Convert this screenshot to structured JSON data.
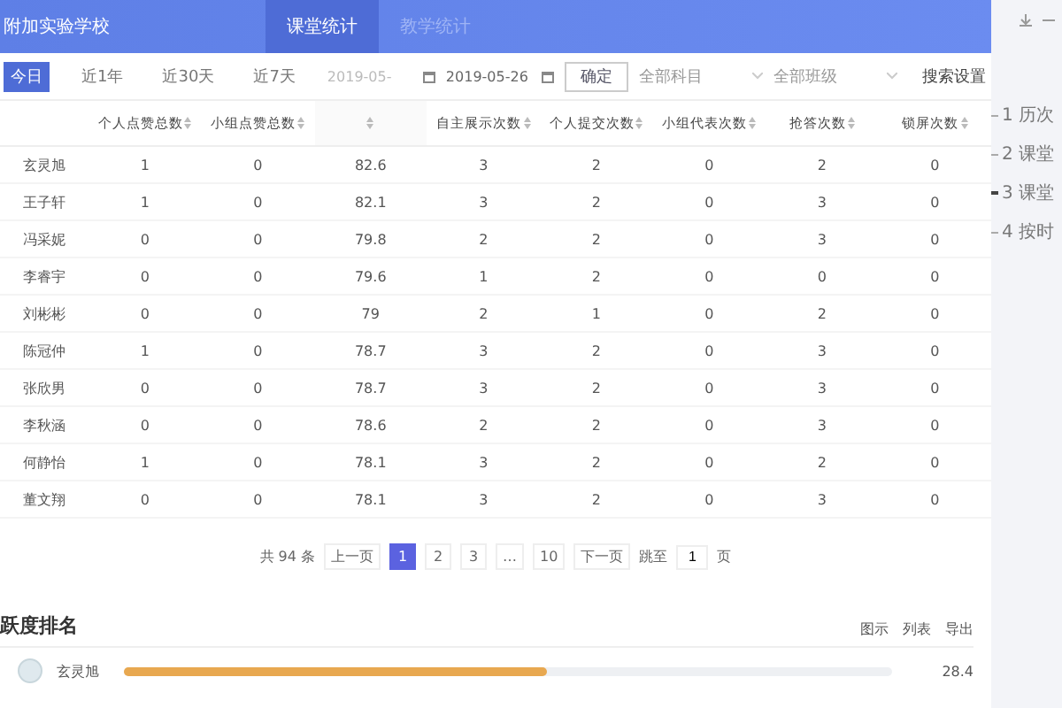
{
  "header": {
    "title": "附加实验学校",
    "tabs": [
      {
        "label": "课堂统计",
        "selected": true
      },
      {
        "label": "教学统计",
        "selected": false
      }
    ]
  },
  "filters": {
    "ranges": [
      {
        "label": "今日",
        "selected": true
      },
      {
        "label": "近1年",
        "selected": false
      },
      {
        "label": "近30天",
        "selected": false
      },
      {
        "label": "近7天",
        "selected": false
      }
    ],
    "start_date": {
      "placeholder": "2019-05-"
    },
    "end_date": {
      "value": "2019-05-26"
    },
    "confirm": "确定",
    "subject": "全部科目",
    "class": "全部班级",
    "search_settings": "搜索设置"
  },
  "table": {
    "columns": [
      {},
      {
        "label": "个人点赞总数"
      },
      {
        "label": "小组点赞总数"
      },
      {},
      {
        "label": "自主展示次数"
      },
      {
        "label": "个人提交次数"
      },
      {
        "label": "小组代表次数"
      },
      {
        "label": "抢答次数"
      },
      {
        "label": "锁屏次数"
      }
    ],
    "rows": [
      [
        "玄灵旭",
        "1",
        "0",
        "82.6",
        "3",
        "2",
        "0",
        "2",
        "0"
      ],
      [
        "王子轩",
        "1",
        "0",
        "82.1",
        "3",
        "2",
        "0",
        "3",
        "0"
      ],
      [
        "冯采妮",
        "0",
        "0",
        "79.8",
        "2",
        "2",
        "0",
        "3",
        "0"
      ],
      [
        "李睿宇",
        "0",
        "0",
        "79.6",
        "1",
        "2",
        "0",
        "0",
        "0"
      ],
      [
        "刘彬彬",
        "0",
        "0",
        "79",
        "2",
        "1",
        "0",
        "2",
        "0"
      ],
      [
        "陈冠仲",
        "1",
        "0",
        "78.7",
        "3",
        "2",
        "0",
        "3",
        "0"
      ],
      [
        "张欣男",
        "0",
        "0",
        "78.7",
        "3",
        "2",
        "0",
        "3",
        "0"
      ],
      [
        "李秋涵",
        "0",
        "0",
        "78.6",
        "2",
        "2",
        "0",
        "3",
        "0"
      ],
      [
        "何静怡",
        "1",
        "0",
        "78.1",
        "3",
        "2",
        "0",
        "2",
        "0"
      ],
      [
        "董文翔",
        "0",
        "0",
        "78.1",
        "3",
        "2",
        "0",
        "3",
        "0"
      ]
    ]
  },
  "pagination": {
    "total": "共 94 条",
    "prev": "上一页",
    "pages": [
      {
        "label": "1",
        "selected": true
      },
      {
        "label": "2",
        "selected": false
      },
      {
        "label": "3",
        "selected": false
      },
      {
        "label": "…",
        "selected": false
      },
      {
        "label": "10",
        "selected": false
      }
    ],
    "next": "下一页",
    "jump": "跳至",
    "page_input": "1",
    "page_unit": "页"
  },
  "ranking": {
    "title": "跃度排名",
    "actions": [
      "图示",
      "列表",
      "导出"
    ],
    "rows": [
      {
        "name": "玄灵旭",
        "level": 0.55,
        "score": "28.4"
      }
    ]
  },
  "outline": [
    {
      "label": "1 历次",
      "selected": false
    },
    {
      "label": "2 课堂",
      "selected": false
    },
    {
      "label": "3 课堂",
      "selected": true
    },
    {
      "label": "4 按时",
      "selected": false
    }
  ]
}
